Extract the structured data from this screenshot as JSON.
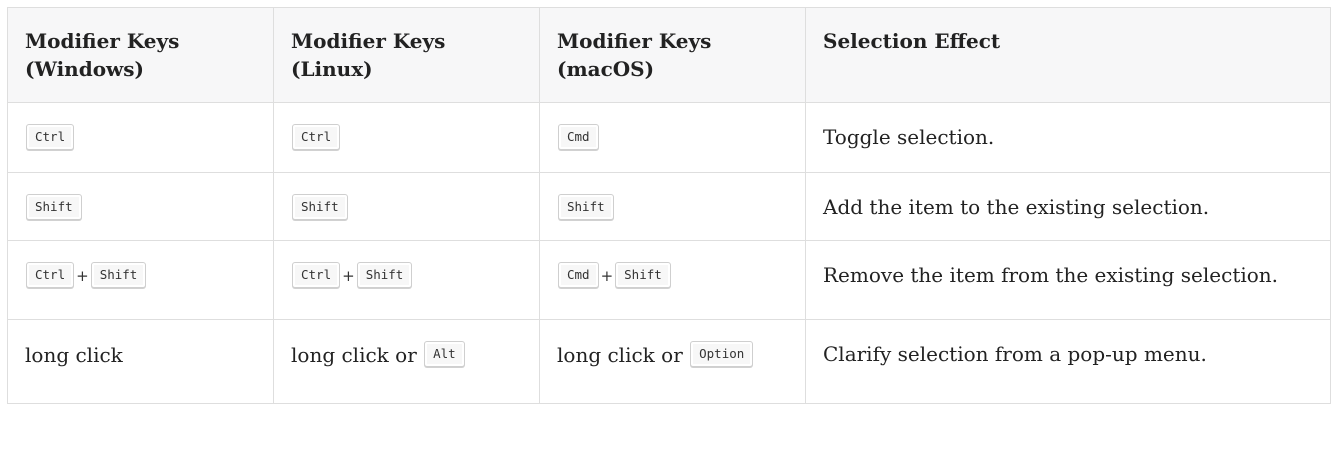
{
  "table": {
    "headers": [
      "Modifier Keys (Windows)",
      "Modifier Keys (Linux)",
      "Modifier Keys (macOS)",
      "Selection Effect"
    ],
    "rows": [
      {
        "windows": {
          "keys": [
            "Ctrl"
          ]
        },
        "linux": {
          "keys": [
            "Ctrl"
          ]
        },
        "macos": {
          "keys": [
            "Cmd"
          ]
        },
        "effect": "Toggle selection."
      },
      {
        "windows": {
          "keys": [
            "Shift"
          ]
        },
        "linux": {
          "keys": [
            "Shift"
          ]
        },
        "macos": {
          "keys": [
            "Shift"
          ]
        },
        "effect": "Add the item to the existing selection."
      },
      {
        "windows": {
          "keys": [
            "Ctrl",
            "Shift"
          ],
          "joiner": "+"
        },
        "linux": {
          "keys": [
            "Ctrl",
            "Shift"
          ],
          "joiner": "+"
        },
        "macos": {
          "keys": [
            "Cmd",
            "Shift"
          ],
          "joiner": "+"
        },
        "effect": "Remove the item from the existing selection."
      },
      {
        "windows": {
          "text": "long click"
        },
        "linux": {
          "text": "long click or",
          "keys": [
            "Alt"
          ]
        },
        "macos": {
          "text": "long click or",
          "keys": [
            "Option"
          ]
        },
        "effect": "Clarify selection from a pop-up menu."
      }
    ]
  }
}
